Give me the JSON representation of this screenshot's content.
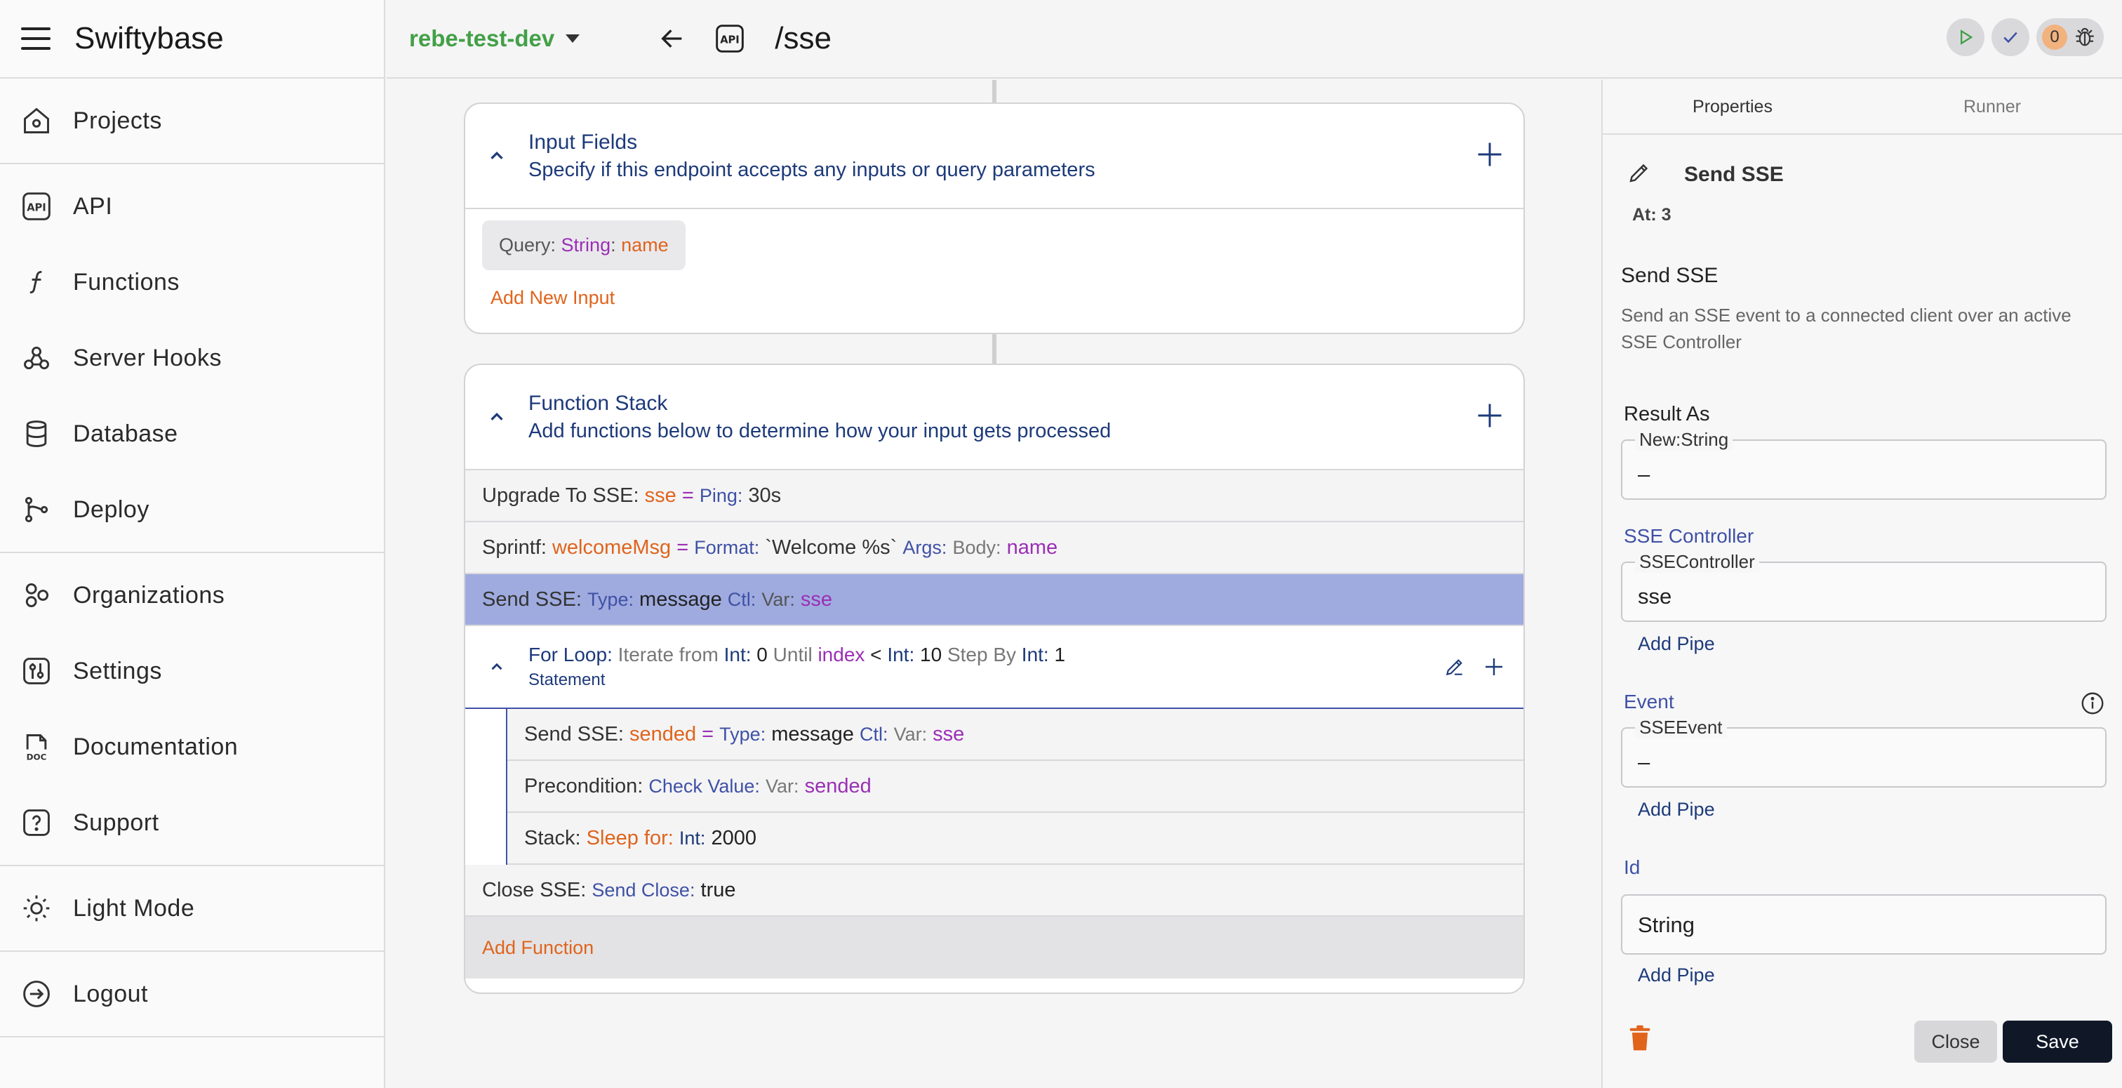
{
  "sidebar": {
    "brand": "Swiftybase",
    "groups": [
      [
        {
          "label": "Projects",
          "icon": "home-icon"
        }
      ],
      [
        {
          "label": "API",
          "icon": "api-icon"
        },
        {
          "label": "Functions",
          "icon": "function-icon"
        },
        {
          "label": "Server Hooks",
          "icon": "webhook-icon"
        },
        {
          "label": "Database",
          "icon": "database-icon"
        },
        {
          "label": "Deploy",
          "icon": "branch-icon"
        }
      ],
      [
        {
          "label": "Organizations",
          "icon": "organizations-icon"
        },
        {
          "label": "Settings",
          "icon": "settings-icon"
        },
        {
          "label": "Documentation",
          "icon": "doc-icon"
        },
        {
          "label": "Support",
          "icon": "help-icon"
        }
      ],
      [
        {
          "label": "Light Mode",
          "icon": "sun-icon"
        }
      ],
      [
        {
          "label": "Logout",
          "icon": "logout-icon"
        }
      ]
    ],
    "api_icon_text": "API",
    "doc_icon_text": "DOC"
  },
  "topbar": {
    "environment": "rebe-test-dev",
    "api_badge": "API",
    "route": "/sse",
    "debug_count": "0",
    "colors": {
      "env": "#43a047",
      "play": "#43a047",
      "check": "#3f51a5",
      "count_bg": "#f2b27e"
    }
  },
  "input_fields": {
    "title": "Input Fields",
    "subtitle": "Specify if this endpoint accepts any inputs or query parameters",
    "chip": {
      "prefix": "Query",
      "type": "String",
      "name": "name"
    },
    "add_label": "Add New Input"
  },
  "function_stack": {
    "title": "Function Stack",
    "subtitle": "Add functions below to determine how your input gets processed",
    "upgrade": {
      "name": "Upgrade To SSE:",
      "var": "sse",
      "eq": "=",
      "key": "Ping:",
      "val": "30s"
    },
    "sprintf": {
      "name": "Sprintf:",
      "var": "welcomeMsg",
      "eq": "=",
      "key1": "Format:",
      "val1": "`Welcome %s`",
      "key2": "Args:",
      "key3": "Body:",
      "val3": "name"
    },
    "send": {
      "name": "Send SSE:",
      "key1": "Type:",
      "val1": "message",
      "key2": "Ctl:",
      "key3": "Var:",
      "val3": "sse"
    },
    "loop": {
      "name": "For Loop:",
      "p1": "Iterate from",
      "t1": "Int:",
      "v1": "0",
      "p2": "Until",
      "idx": "index",
      "lt": "<",
      "t2": "Int:",
      "v2": "10",
      "p3": "Step By",
      "t3": "Int:",
      "v3": "1",
      "sub": "Statement",
      "children": {
        "send": {
          "name": "Send SSE:",
          "var": "sended",
          "eq": "=",
          "key1": "Type:",
          "val1": "message",
          "key2": "Ctl:",
          "key3": "Var:",
          "val3": "sse"
        },
        "pre": {
          "name": "Precondition:",
          "key1": "Check Value:",
          "key2": "Var:",
          "val2": "sended"
        },
        "stack": {
          "name": "Stack:",
          "key1": "Sleep for:",
          "key2": "Int:",
          "val2": "2000"
        }
      }
    },
    "close": {
      "name": "Close SSE:",
      "key": "Send Close:",
      "val": "true"
    },
    "add_label": "Add Function"
  },
  "panel": {
    "tabs": [
      "Properties",
      "Runner"
    ],
    "title": "Send SSE",
    "at": "At: 3",
    "desc_title": "Send SSE",
    "desc": "Send an SSE event to a connected client over an active SSE Controller",
    "result_label": "Result As",
    "result_legend": "New:String",
    "result_value": "–",
    "ctrl_label": "SSE Controller",
    "ctrl_legend": "SSEController",
    "ctrl_value": "sse",
    "event_label": "Event",
    "event_legend": "SSEEvent",
    "event_value": "–",
    "id_label": "Id",
    "id_value": "String",
    "add_pipe": "Add Pipe",
    "close": "Close",
    "save": "Save"
  }
}
